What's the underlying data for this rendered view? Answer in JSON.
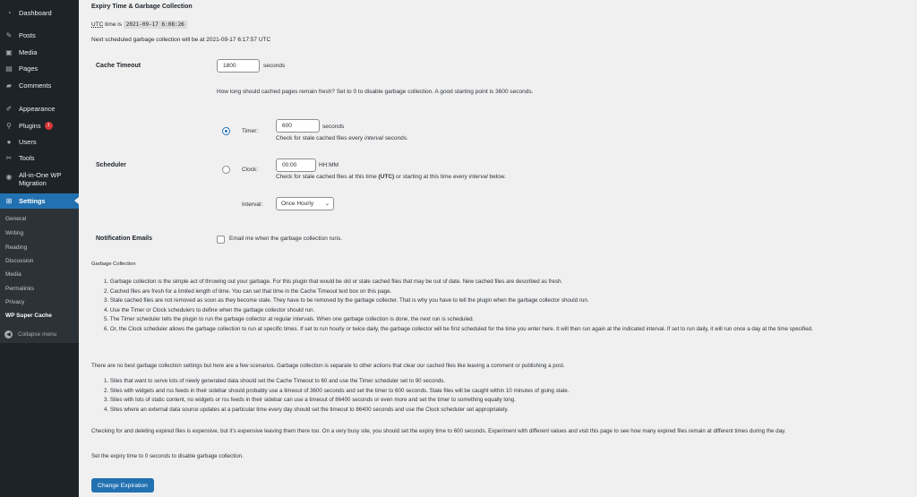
{
  "sidebar": {
    "items": [
      {
        "label": "Dashboard",
        "icon": "dashboard-icon"
      },
      {
        "label": "Posts",
        "icon": "pin-icon"
      },
      {
        "label": "Media",
        "icon": "media-icon"
      },
      {
        "label": "Pages",
        "icon": "pages-icon"
      },
      {
        "label": "Comments",
        "icon": "comment-icon"
      },
      {
        "label": "Appearance",
        "icon": "brush-icon"
      },
      {
        "label": "Plugins",
        "icon": "plugin-icon",
        "badge": "1"
      },
      {
        "label": "Users",
        "icon": "user-icon"
      },
      {
        "label": "Tools",
        "icon": "wrench-icon"
      },
      {
        "label": "All-in-One WP",
        "label2": "Migration",
        "icon": "migration-icon"
      },
      {
        "label": "Settings",
        "icon": "settings-icon"
      }
    ],
    "submenu": [
      "General",
      "Writing",
      "Reading",
      "Discussion",
      "Media",
      "Permalinks",
      "Privacy",
      "WP Super Cache"
    ],
    "collapse_label": "Collapse menu"
  },
  "main": {
    "section_title": "Expiry Time & Garbage Collection",
    "utc_prefix": "UTC",
    "utc_mid": " time is ",
    "utc_time": "2021-09-17 6:08:26",
    "next_gc": "Next scheduled garbage collection will be at 2021-09-17 6:17:57 UTC",
    "cache_timeout_label": "Cache Timeout",
    "cache_timeout_value": "1800",
    "seconds": "seconds",
    "cache_timeout_desc": "How long should cached pages remain fresh? Set to 0 to disable garbage collection. A good starting point is 3600 seconds.",
    "scheduler_label": "Scheduler",
    "timer_label": "Timer:",
    "timer_value": "600",
    "timer_desc_a": "Check for stale cached files every ",
    "timer_desc_b": "interval",
    "timer_desc_c": " seconds.",
    "clock_label": "Clock:",
    "clock_value": "00:00",
    "clock_unit": "HH:MM",
    "clock_desc_a": "Check for stale cached files at this time ",
    "clock_desc_b": "(UTC)",
    "clock_desc_c": " or starting at this time every ",
    "clock_desc_d": "interval",
    "clock_desc_e": " below.",
    "interval_label": "Interval:",
    "interval_value": "Once Hourly",
    "notification_label": "Notification Emails",
    "notification_text": "Email me when the garbage collection runs.",
    "gc_title": "Garbage Collection",
    "gc_list": [
      "1. Garbage collection is the simple act of throwing out your garbage. For this plugin that would be old or stale cached files that may be out of date. New cached files are described as fresh.",
      "2. Cached files are fresh for a limited length of time. You can set that time in the Cache Timeout text box on this page.",
      "3. Stale cached files are not removed as soon as they become stale. They have to be removed by the garbage collecter. That is why you have to tell the plugin when the garbage collector should run.",
      "4. Use the Timer or Clock schedulers to define when the garbage collector should run.",
      "5. The Timer scheduler tells the plugin to run the garbage collector at regular intervals. When one garbage collection is done, the next run is scheduled.",
      "6. Or, the Clock scheduler allows the garbage collection to run at specific times. If set to run hourly or twice daily, the garbage collector will be first scheduled for the time you enter here. It will then run again at the indicated interval. If set to run daily, it will run once a day at the time specified."
    ],
    "scenarios_intro": "There are no best garbage collection settings but here are a few scenarios. Garbage collection is separate to other actions that clear our cached files like leaving a comment or publishing a post.",
    "scenarios": [
      "1. Sites that want to serve lots of newly generated data should set the Cache Timeout to 60 and use the Timer scheduler set to 90 seconds.",
      "2. Sites with widgets and rss feeds in their sidebar should probably use a timeout of 3600 seconds and set the timer to 600 seconds. Stale files will be caught within 10 minutes of going stale.",
      "3. Sites with lots of static content, no widgets or rss feeds in their sidebar can use a timeout of 86400 seconds or even more and set the timer to something equally long.",
      "4. Sites where an external data source updates at a particular time every day should set the timeout to 86400 seconds and use the Clock scheduler set appropriately."
    ],
    "expensive_note": "Checking for and deleting expired files is expensive, but it's expensive leaving them there too. On a very busy site, you should set the expiry time to 600 seconds. Experiment with different values and visit this page to see how many expired files remain at different times during the day.",
    "disable_note": "Set the expiry time to 0 seconds to disable garbage collection.",
    "button_label": "Change Expiration"
  },
  "colors": {
    "sidebar_bg": "#1d2327",
    "accent": "#2271b1",
    "badge": "#d63638",
    "page_bg": "#f0f0f1"
  }
}
